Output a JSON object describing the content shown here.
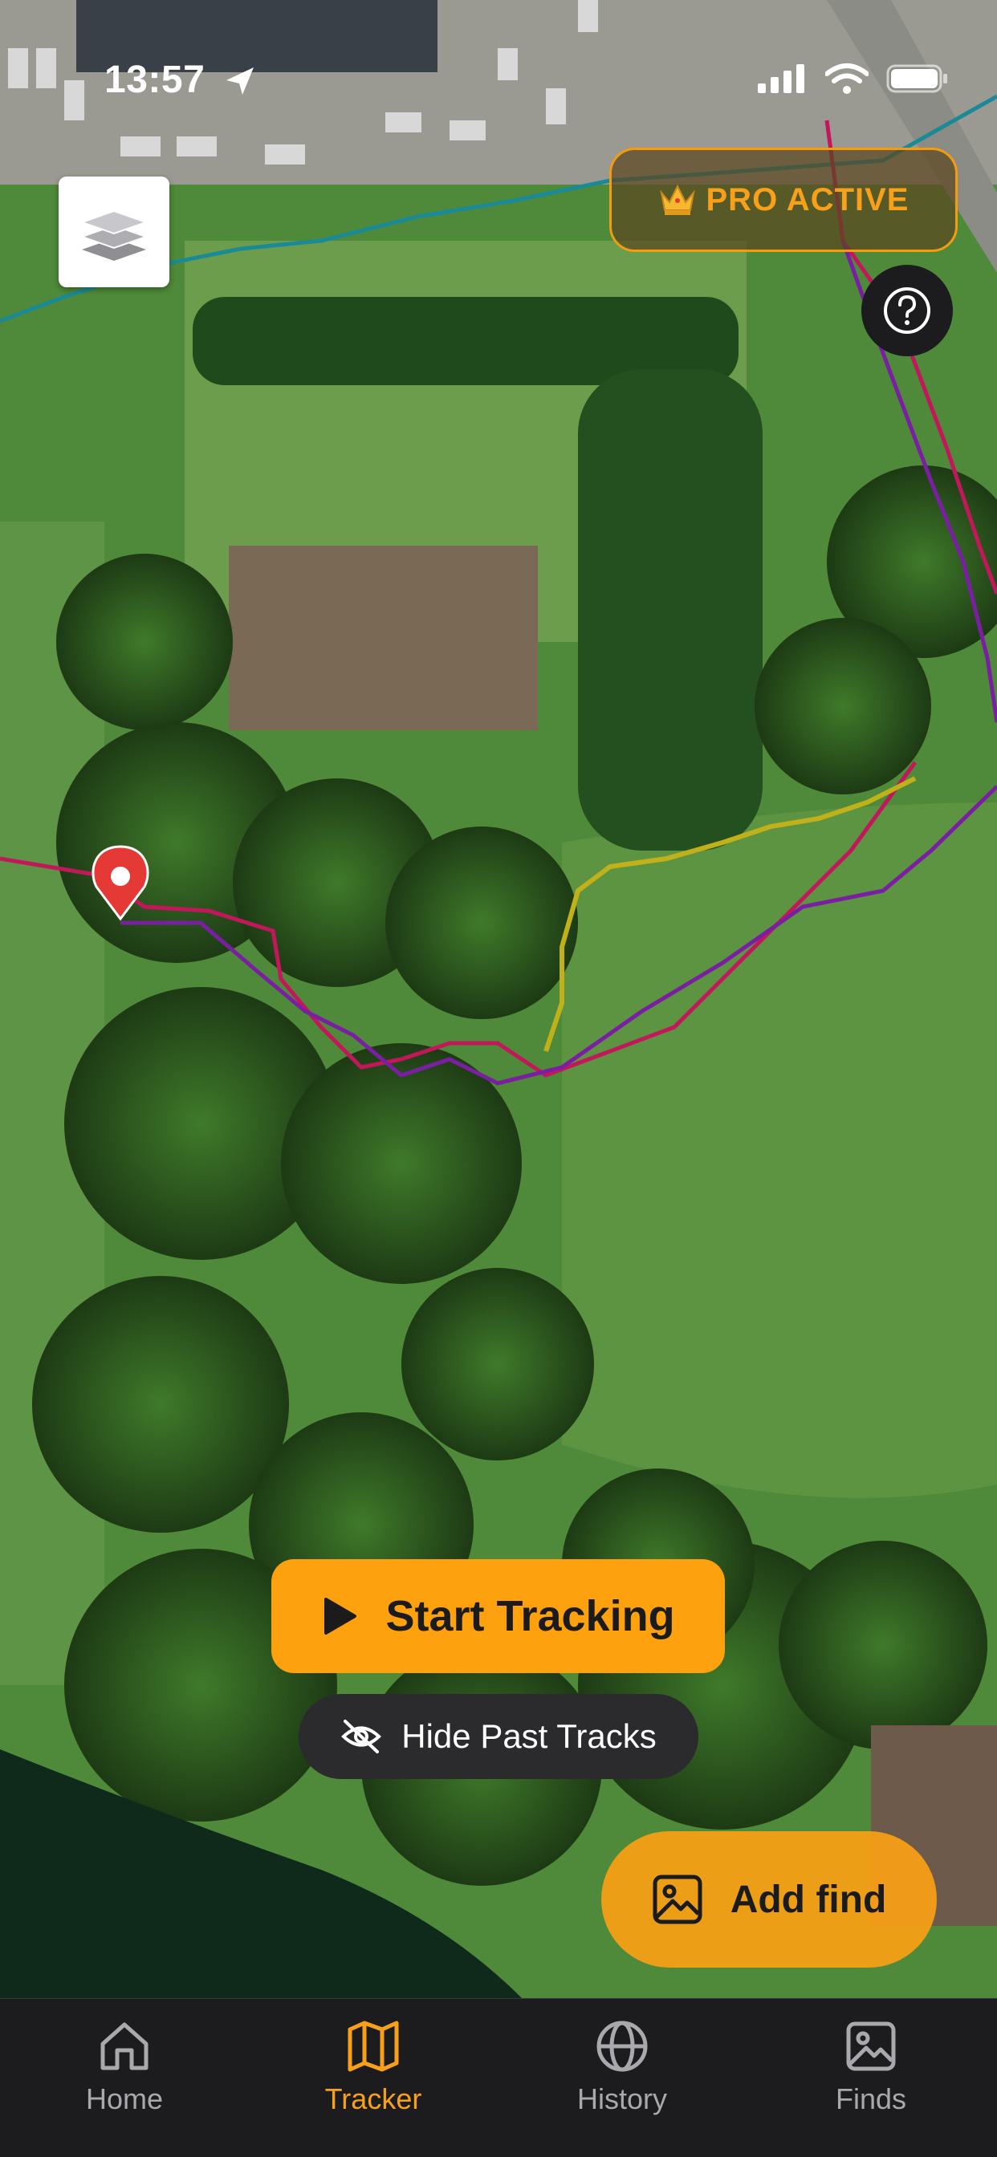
{
  "status_bar": {
    "time": "13:57"
  },
  "map": {
    "buttons": {
      "layers": "layers-icon",
      "help": "question-icon"
    },
    "track_colors": [
      "#1a8a96",
      "#c2185b",
      "#7b1fa2",
      "#c0b11a"
    ],
    "pin_color": "#e53935"
  },
  "pro_badge": {
    "icon": "crown",
    "label": "PRO ACTIVE"
  },
  "actions": {
    "start_tracking": "Start Tracking",
    "hide_past_tracks": "Hide Past Tracks",
    "add_find": "Add find"
  },
  "tab_bar": {
    "active": "Tracker",
    "items": [
      {
        "label": "Home",
        "icon": "home-icon"
      },
      {
        "label": "Tracker",
        "icon": "map-icon"
      },
      {
        "label": "History",
        "icon": "globe-icon"
      },
      {
        "label": "Finds",
        "icon": "image-icon"
      }
    ]
  },
  "colors": {
    "accent": "#f7a11a",
    "tab_bar_bg": "#1c1c1e"
  }
}
